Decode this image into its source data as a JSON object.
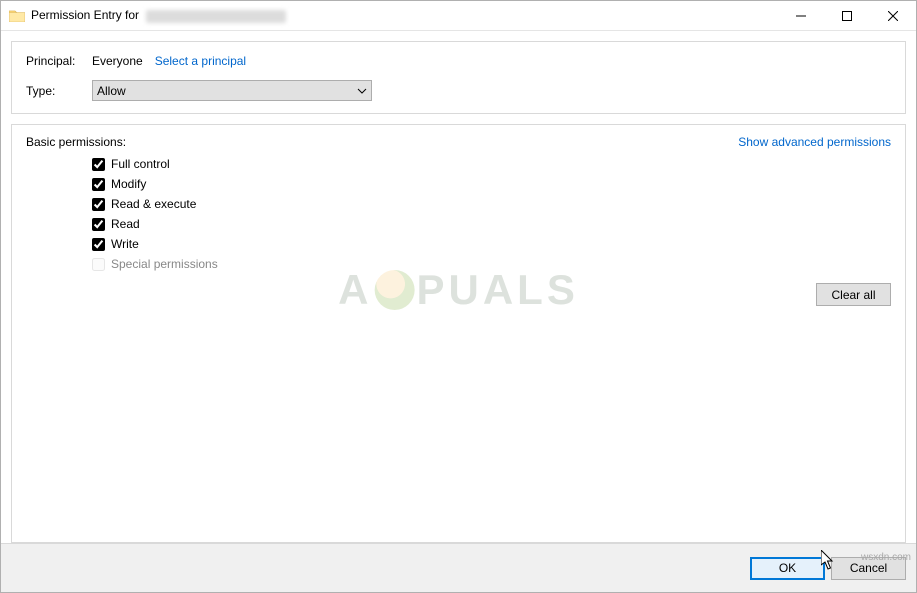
{
  "titlebar": {
    "title_prefix": "Permission Entry for"
  },
  "panel_principal": {
    "principal_label": "Principal:",
    "principal_value": "Everyone",
    "select_principal_link": "Select a principal",
    "type_label": "Type:",
    "type_value": "Allow"
  },
  "panel_permissions": {
    "section_label": "Basic permissions:",
    "advanced_link": "Show advanced permissions",
    "clear_all_label": "Clear all",
    "items": [
      {
        "label": "Full control",
        "checked": true,
        "enabled": true
      },
      {
        "label": "Modify",
        "checked": true,
        "enabled": true
      },
      {
        "label": "Read & execute",
        "checked": true,
        "enabled": true
      },
      {
        "label": "Read",
        "checked": true,
        "enabled": true
      },
      {
        "label": "Write",
        "checked": true,
        "enabled": true
      },
      {
        "label": "Special permissions",
        "checked": false,
        "enabled": false
      }
    ]
  },
  "buttons": {
    "ok": "OK",
    "cancel": "Cancel"
  },
  "watermark": {
    "text_left": "A",
    "text_right": "PUALS"
  },
  "site_tag": "wsxdn.com"
}
